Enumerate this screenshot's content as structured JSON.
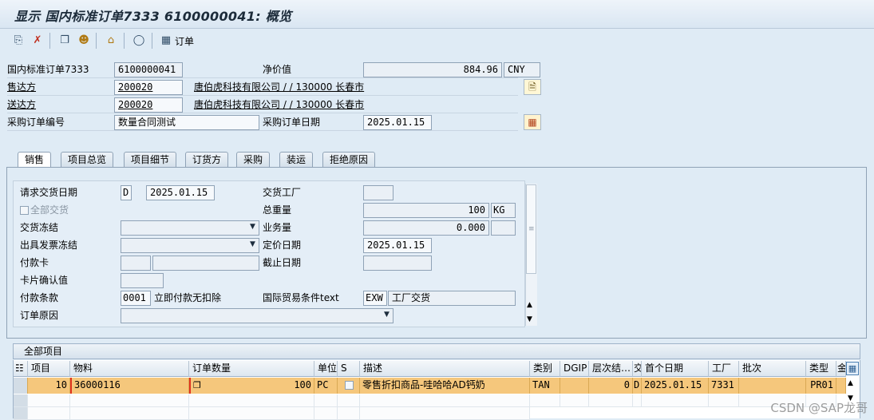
{
  "window": {
    "title": "显示 国内标准订单7333 6100000041: 概览"
  },
  "toolbar": {
    "order_label": "订单",
    "icons": [
      "display-doc-icon",
      "delete-icon",
      "copy-icon",
      "partner-icon",
      "home-icon",
      "docflow-icon",
      "table-icon"
    ]
  },
  "header": {
    "order_type_label": "国内标准订单7333",
    "order_number": "6100000041",
    "net_value_label": "净价值",
    "net_value": "884.96",
    "currency": "CNY",
    "sold_to_label": "售达方",
    "sold_to_code": "200020",
    "sold_to_desc": "唐伯虎科技有限公司 / / 130000 长春市",
    "ship_to_label": "送达方",
    "ship_to_code": "200020",
    "ship_to_desc": "唐伯虎科技有限公司 / / 130000 长春市",
    "po_number_label": "采购订单编号",
    "po_number": "数量合同测试",
    "po_date_label": "采购订单日期",
    "po_date": "2025.01.15"
  },
  "tabs": [
    {
      "label": "销售",
      "active": true
    },
    {
      "label": "项目总览",
      "active": false
    },
    {
      "label": "项目细节",
      "active": false
    },
    {
      "label": "订货方",
      "active": false
    },
    {
      "label": "采购",
      "active": false
    },
    {
      "label": "装运",
      "active": false
    },
    {
      "label": "拒绝原因",
      "active": false
    }
  ],
  "sales": {
    "req_delivery_date_label": "请求交货日期",
    "req_delivery_date_type": "D",
    "req_delivery_date": "2025.01.15",
    "delivery_plant_label": "交货工厂",
    "delivery_plant": "",
    "complete_delivery_label": "全部交货",
    "total_weight_label": "总重量",
    "total_weight": "100",
    "weight_unit": "KG",
    "delivery_block_label": "交货冻结",
    "volume_label": "业务量",
    "volume": "0.000",
    "billing_block_label": "出具发票冻结",
    "pricing_date_label": "定价日期",
    "pricing_date": "2025.01.15",
    "payment_card_label": "付款卡",
    "valid_to_label": "截止日期",
    "card_verif_label": "卡片确认值",
    "payment_terms_label": "付款条款",
    "payment_terms_code": "0001",
    "payment_terms_desc": "立即付款无扣除",
    "incoterms_label": "国际贸易条件text",
    "incoterms_code": "EXW",
    "incoterms_desc": "工厂交货",
    "order_reason_label": "订单原因"
  },
  "items": {
    "title": "全部项目",
    "columns": [
      "项目",
      "物料",
      "订单数量",
      "单位",
      "S",
      "描述",
      "类别",
      "DGIP",
      "层次结…",
      "交",
      "首个日期",
      "工厂",
      "批次",
      "类型",
      "金"
    ],
    "rows": [
      {
        "item": "10",
        "material": "36000116",
        "quantity": "100",
        "unit": "PC",
        "description": "零售折扣商品-哇哈哈AD钙奶",
        "category": "TAN",
        "hier": "0",
        "deliv": "D",
        "first_date": "2025.01.15",
        "plant": "7331",
        "pricing_type": "PR01"
      }
    ]
  },
  "watermark": "CSDN @SAP龙哥"
}
